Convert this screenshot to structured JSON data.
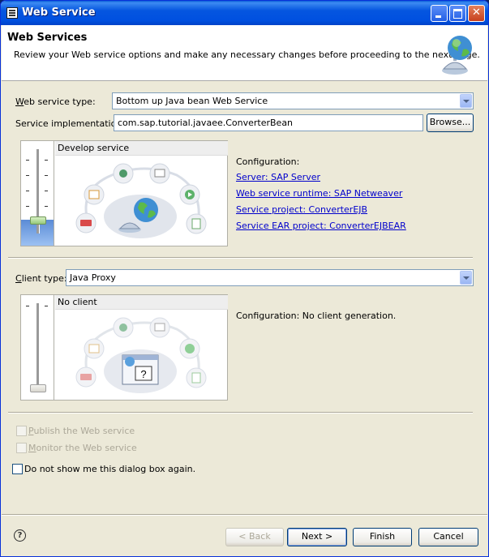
{
  "window": {
    "title": "Web Service"
  },
  "header": {
    "title": "Web Services",
    "description": "Review your Web service options and make any necessary changes before proceeding to the next page."
  },
  "service": {
    "type_label_u": "W",
    "type_label_rest": "eb service type:",
    "type_value": "Bottom up Java bean Web Service",
    "impl_label": "Service implementation:",
    "impl_value": "com.sap.tutorial.javaee.ConverterBean",
    "browse_label": "Browse...",
    "stage_title": "Develop service",
    "slider_level": 0.25,
    "config_label": "Configuration:",
    "links": {
      "server": "Server: SAP Server",
      "runtime": "Web service runtime: SAP Netweaver",
      "project": "Service project: ConverterEJB",
      "ear": "Service EAR project: ConverterEJBEAR"
    }
  },
  "client": {
    "type_label_u": "C",
    "type_label_rest": "lient type:",
    "type_value": "Java Proxy",
    "stage_title": "No client",
    "slider_level": 0,
    "config_text": "Configuration: No client generation."
  },
  "options": {
    "publish_u": "P",
    "publish_rest": "ublish the Web service",
    "monitor_u": "M",
    "monitor_rest": "onitor the Web service",
    "donotshow": "Do not show me this dialog box again."
  },
  "footer": {
    "back_label": "< Back",
    "next_label": "Next >",
    "finish_label": "Finish",
    "cancel_label": "Cancel",
    "help_glyph": "?"
  }
}
